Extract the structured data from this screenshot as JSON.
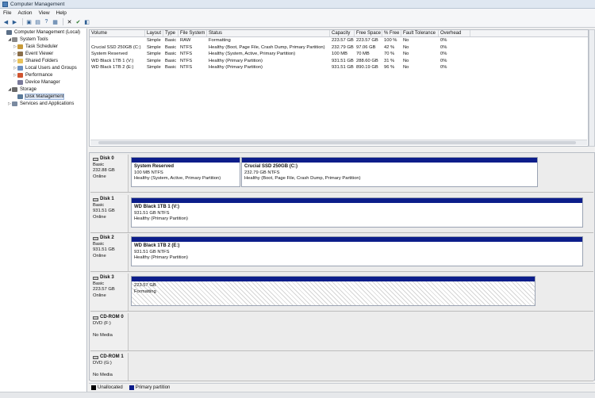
{
  "window": {
    "title": "Computer Management"
  },
  "menu": [
    "File",
    "Action",
    "View",
    "Help"
  ],
  "toolbar_icons": [
    "back-arrow-icon",
    "forward-arrow-icon",
    "up-folder-icon",
    "properties-icon",
    "help-icon",
    "export-icon",
    "delete-icon",
    "check-icon",
    "more-icon"
  ],
  "tree": [
    {
      "label": "Computer Management (Local)",
      "level": 0,
      "twisty": "",
      "icon": "computer-icon",
      "color": "#5b6f87"
    },
    {
      "label": "System Tools",
      "level": 1,
      "twisty": "◢",
      "icon": "tools-icon",
      "color": "#8a8a8a"
    },
    {
      "label": "Task Scheduler",
      "level": 2,
      "twisty": "▷",
      "icon": "clock-icon",
      "color": "#c79a3a"
    },
    {
      "label": "Event Viewer",
      "level": 2,
      "twisty": "▷",
      "icon": "event-icon",
      "color": "#8a6e4a"
    },
    {
      "label": "Shared Folders",
      "level": 2,
      "twisty": "▷",
      "icon": "folder-icon",
      "color": "#e8c25a"
    },
    {
      "label": "Local Users and Groups",
      "level": 2,
      "twisty": "▷",
      "icon": "users-icon",
      "color": "#6a8fc0"
    },
    {
      "label": "Performance",
      "level": 2,
      "twisty": "▷",
      "icon": "performance-icon",
      "color": "#d0542f"
    },
    {
      "label": "Device Manager",
      "level": 2,
      "twisty": "",
      "icon": "device-icon",
      "color": "#7a7a9a"
    },
    {
      "label": "Storage",
      "level": 1,
      "twisty": "◢",
      "icon": "storage-icon",
      "color": "#6a6a6a"
    },
    {
      "label": "Disk Management",
      "level": 2,
      "twisty": "",
      "icon": "disk-icon",
      "color": "#5a7a9a",
      "selected": true
    },
    {
      "label": "Services and Applications",
      "level": 1,
      "twisty": "▷",
      "icon": "services-icon",
      "color": "#7a8aa0"
    }
  ],
  "volumes": {
    "columns": [
      "Volume",
      "Layout",
      "Type",
      "File System",
      "Status",
      "Capacity",
      "Free Space",
      "% Free",
      "Fault Tolerance",
      "Overhead"
    ],
    "rows": [
      [
        "",
        "Simple",
        "Basic",
        "RAW",
        "Formatting",
        "223.57 GB",
        "223.57 GB",
        "100 %",
        "No",
        "0%"
      ],
      [
        "Crucial SSD 250GB (C:)",
        "Simple",
        "Basic",
        "NTFS",
        "Healthy (Boot, Page File, Crash Dump, Primary Partition)",
        "232.79 GB",
        "97.06 GB",
        "42 %",
        "No",
        "0%"
      ],
      [
        "System Reserved",
        "Simple",
        "Basic",
        "NTFS",
        "Healthy (System, Active, Primary Partition)",
        "100 MB",
        "70 MB",
        "70 %",
        "No",
        "0%"
      ],
      [
        "WD Black 1TB 1 (V:)",
        "Simple",
        "Basic",
        "NTFS",
        "Healthy (Primary Partition)",
        "931.51 GB",
        "288.60 GB",
        "31 %",
        "No",
        "0%"
      ],
      [
        "WD Black 1TB 2 (E:)",
        "Simple",
        "Basic",
        "NTFS",
        "Healthy (Primary Partition)",
        "931.51 GB",
        "890.19 GB",
        "96 %",
        "No",
        "0%"
      ]
    ]
  },
  "disks": [
    {
      "name": "Disk 0",
      "type": "Basic",
      "size": "232.88 GB",
      "state": "Online",
      "partitions": [
        {
          "name": "System Reserved",
          "size": "100 MB NTFS",
          "status": "Healthy (System, Active, Primary Partition)"
        },
        {
          "name": "Crucial SSD 250GB  (C:)",
          "size": "232.79 GB NTFS",
          "status": "Healthy (Boot, Page File, Crash Dump, Primary Partition)"
        }
      ]
    },
    {
      "name": "Disk 1",
      "type": "Basic",
      "size": "931.51 GB",
      "state": "Online",
      "partitions": [
        {
          "name": "WD Black 1TB 1  (V:)",
          "size": "931.51 GB NTFS",
          "status": "Healthy (Primary Partition)"
        }
      ]
    },
    {
      "name": "Disk 2",
      "type": "Basic",
      "size": "931.51 GB",
      "state": "Online",
      "partitions": [
        {
          "name": "WD Black 1TB 2  (E:)",
          "size": "931.51 GB NTFS",
          "status": "Healthy (Primary Partition)"
        }
      ]
    },
    {
      "name": "Disk 3",
      "type": "Basic",
      "size": "223.57 GB",
      "state": "Online",
      "partitions": [
        {
          "name": "",
          "size": "223.57 GB",
          "status": "Formatting"
        }
      ]
    },
    {
      "name": "CD-ROM 0",
      "type": "DVD (F:)",
      "size": "",
      "state": "No Media",
      "partitions": []
    },
    {
      "name": "CD-ROM 1",
      "type": "DVD (G:)",
      "size": "",
      "state": "No Media",
      "partitions": []
    }
  ],
  "legend": [
    {
      "label": "Unallocated",
      "color": "#000000"
    },
    {
      "label": "Primary partition",
      "color": "#0c1d8a"
    }
  ]
}
